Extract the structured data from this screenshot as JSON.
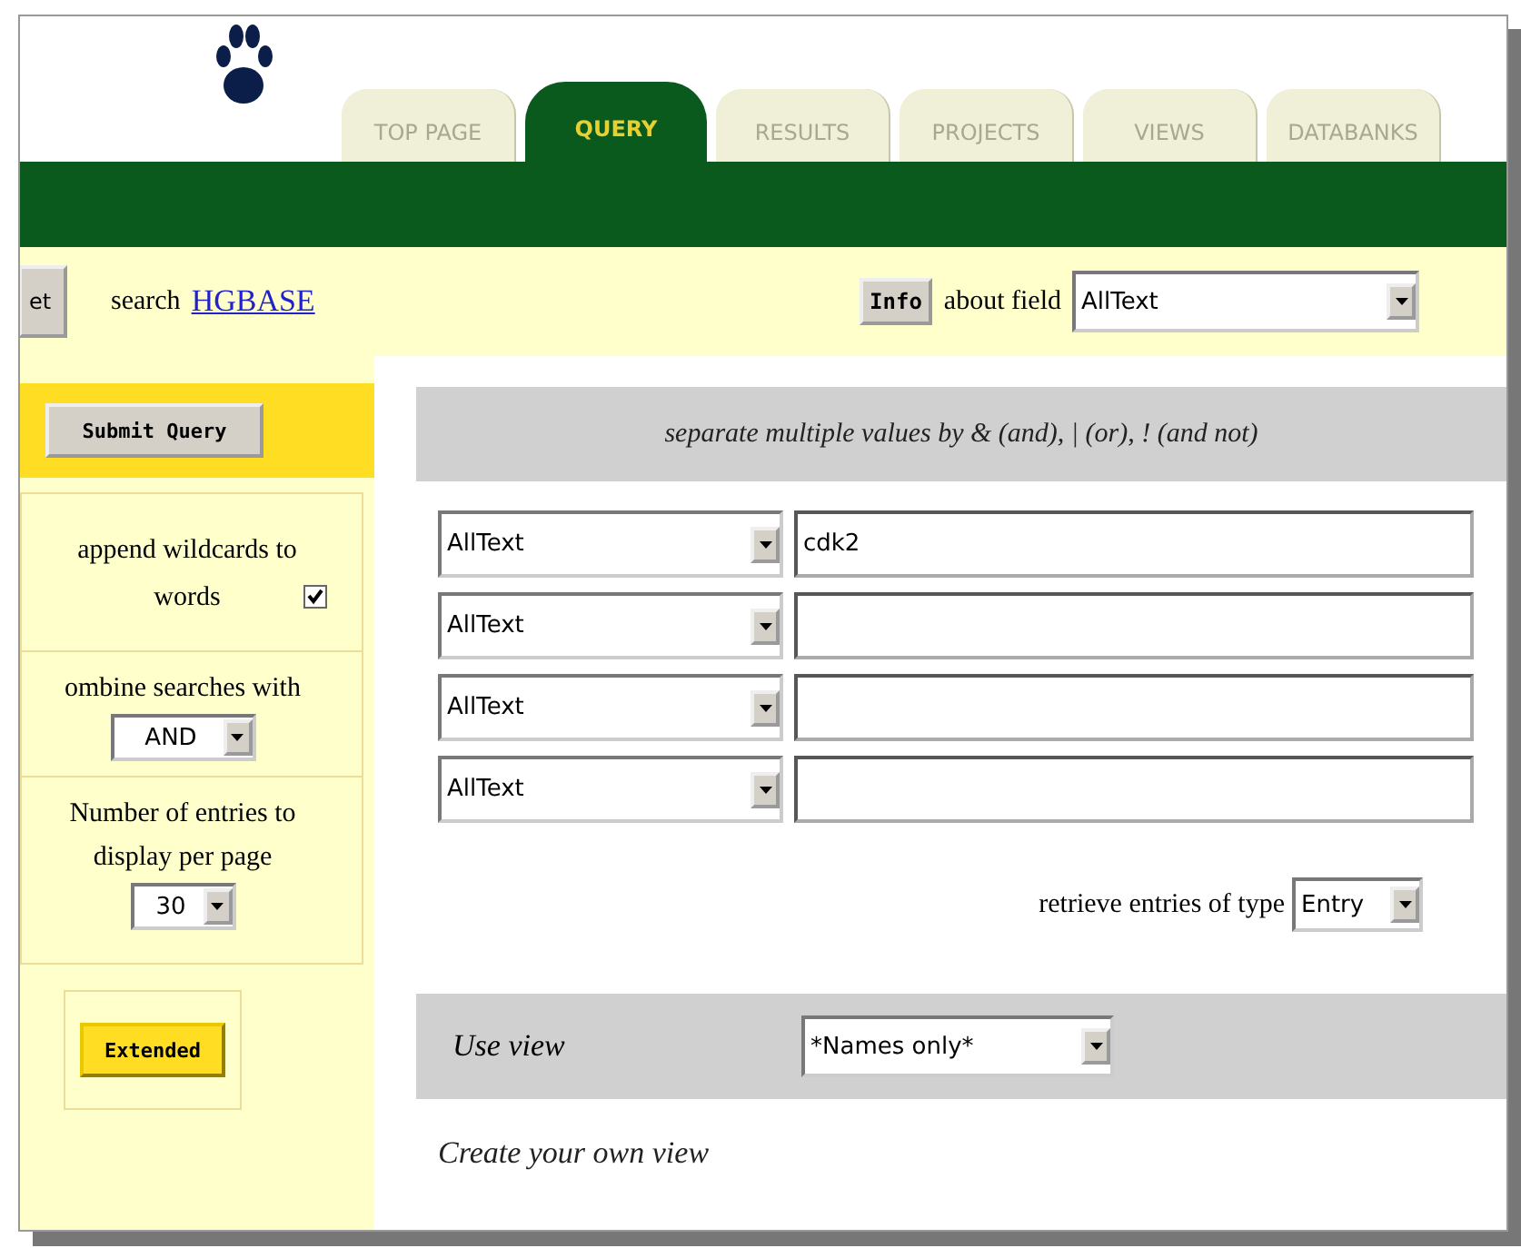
{
  "nav_tabs": [
    {
      "label": "TOP PAGE",
      "selected": false
    },
    {
      "label": "QUERY",
      "selected": true
    },
    {
      "label": "RESULTS",
      "selected": false
    },
    {
      "label": "PROJECTS",
      "selected": false
    },
    {
      "label": "VIEWS",
      "selected": false
    },
    {
      "label": "DATABANKS",
      "selected": false
    }
  ],
  "toolbar": {
    "reset_button": "et",
    "search_label": "search",
    "database_link": "HGBASE",
    "info_button": "Info",
    "about_label": "about field",
    "field_select": "AllText"
  },
  "sidebar": {
    "submit_button": "Submit Query",
    "wildcards": {
      "label": "append wildcards to words",
      "checked": true
    },
    "combine": {
      "label": "ombine searches with",
      "value": "AND"
    },
    "entries": {
      "label": "Number of entries to display per page",
      "value": "30"
    },
    "extended_button": "Extended"
  },
  "query": {
    "hint": "separate multiple values by & (and), | (or), ! (and not)",
    "rows": [
      {
        "field": "AllText",
        "value": "cdk2"
      },
      {
        "field": "AllText"
      },
      {
        "field": "AllText"
      },
      {
        "field": "AllText"
      }
    ],
    "type_label": "retrieve entries of type",
    "type_value": "Entry"
  },
  "view": {
    "label": "Use view",
    "value": "*Names only*",
    "create_link": "Create your own view"
  }
}
